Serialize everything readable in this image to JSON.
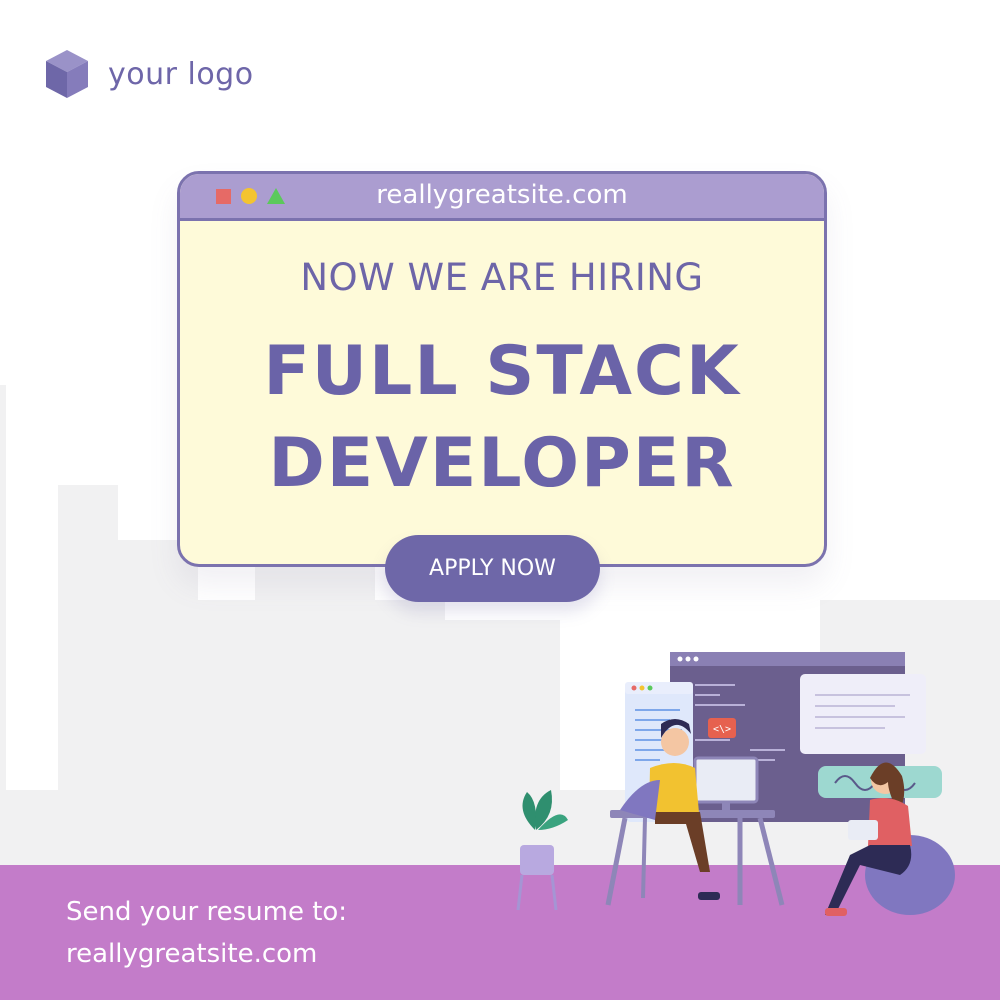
{
  "logo": {
    "text": "your logo",
    "icon": "cube-icon"
  },
  "window": {
    "url": "reallygreatsite.com",
    "subtitle": "NOW WE ARE HIRING",
    "title_line1": "FULL STACK",
    "title_line2": "DEVELOPER"
  },
  "cta": {
    "label": "APPLY NOW"
  },
  "footer": {
    "line1": "Send your resume to:",
    "line2": "reallygreatsite.com"
  },
  "colors": {
    "primary": "#6e67a8",
    "window_bg": "#fefad9",
    "title_bar": "#ab9dd0",
    "footer_bg": "#c37cc9"
  }
}
